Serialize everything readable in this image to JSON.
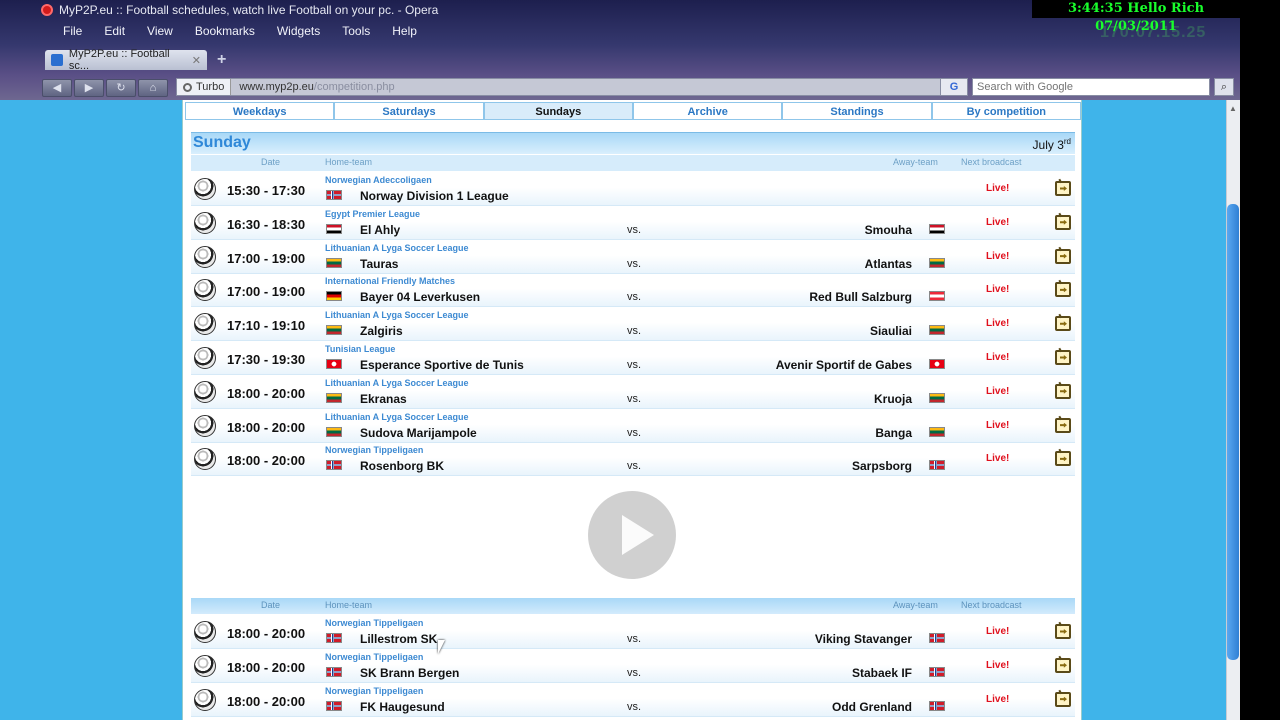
{
  "window": {
    "title": "MyP2P.eu :: Football schedules, watch live Football on your pc. - Opera",
    "clock_overlay": "3:44:35 Hello Rich 07/03/2011",
    "clock_ghost": "170:07.15.25"
  },
  "menu": [
    "File",
    "Edit",
    "View",
    "Bookmarks",
    "Widgets",
    "Tools",
    "Help"
  ],
  "tab": {
    "label": "MyP2P.eu :: Football sc...",
    "close": "✕"
  },
  "newtab": "+",
  "address": {
    "turbo": "Turbo",
    "domain": "www.myp2p.eu",
    "path": "/competition.php"
  },
  "search": {
    "placeholder": "Search with Google",
    "engine": "G"
  },
  "nav_tabs": [
    {
      "label": "Weekdays"
    },
    {
      "label": "Saturdays"
    },
    {
      "label": "Sundays",
      "active": true
    },
    {
      "label": "Archive"
    },
    {
      "label": "Standings"
    },
    {
      "label": "By competition"
    }
  ],
  "section": {
    "day": "Sunday",
    "date": "July 3",
    "date_sup": "rd"
  },
  "columns": {
    "date": "Date",
    "home": "Home-team",
    "away": "Away-team",
    "next": "Next broadcast"
  },
  "matches_top": [
    {
      "time": "15:30 - 17:30",
      "league": "Norwegian Adeccoligaen",
      "home": "Norway Division 1 League",
      "vs": "",
      "away": "",
      "home_flag": "no",
      "away_flag": "",
      "status": "Live!"
    },
    {
      "time": "16:30 - 18:30",
      "league": "Egypt Premier League",
      "home": "El Ahly",
      "vs": "vs.",
      "away": "Smouha",
      "home_flag": "eg",
      "away_flag": "eg",
      "status": "Live!"
    },
    {
      "time": "17:00 - 19:00",
      "league": "Lithuanian A Lyga Soccer League",
      "home": "Tauras",
      "vs": "vs.",
      "away": "Atlantas",
      "home_flag": "lt",
      "away_flag": "lt",
      "status": "Live!"
    },
    {
      "time": "17:00 - 19:00",
      "league": "International Friendly Matches",
      "home": "Bayer 04 Leverkusen",
      "vs": "vs.",
      "away": "Red Bull Salzburg",
      "home_flag": "de",
      "away_flag": "at",
      "status": "Live!"
    },
    {
      "time": "17:10 - 19:10",
      "league": "Lithuanian A Lyga Soccer League",
      "home": "Zalgiris",
      "vs": "vs.",
      "away": "Siauliai",
      "home_flag": "lt",
      "away_flag": "lt",
      "status": "Live!"
    },
    {
      "time": "17:30 - 19:30",
      "league": "Tunisian League",
      "home": "Esperance Sportive de Tunis",
      "vs": "vs.",
      "away": "Avenir Sportif de Gabes",
      "home_flag": "tn",
      "away_flag": "tn",
      "status": "Live!"
    },
    {
      "time": "18:00 - 20:00",
      "league": "Lithuanian A Lyga Soccer League",
      "home": "Ekranas",
      "vs": "vs.",
      "away": "Kruoja",
      "home_flag": "lt",
      "away_flag": "lt",
      "status": "Live!"
    },
    {
      "time": "18:00 - 20:00",
      "league": "Lithuanian A Lyga Soccer League",
      "home": "Sudova Marijampole",
      "vs": "vs.",
      "away": "Banga",
      "home_flag": "lt",
      "away_flag": "lt",
      "status": "Live!"
    },
    {
      "time": "18:00 - 20:00",
      "league": "Norwegian Tippeligaen",
      "home": "Rosenborg BK",
      "vs": "vs.",
      "away": "Sarpsborg",
      "home_flag": "no",
      "away_flag": "no",
      "status": "Live!"
    }
  ],
  "matches_bottom": [
    {
      "time": "18:00 - 20:00",
      "league": "Norwegian Tippeligaen",
      "home": "Lillestrom SK",
      "vs": "vs.",
      "away": "Viking Stavanger",
      "home_flag": "no",
      "away_flag": "no",
      "status": "Live!"
    },
    {
      "time": "18:00 - 20:00",
      "league": "Norwegian Tippeligaen",
      "home": "SK Brann Bergen",
      "vs": "vs.",
      "away": "Stabaek IF",
      "home_flag": "no",
      "away_flag": "no",
      "status": "Live!"
    },
    {
      "time": "18:00 - 20:00",
      "league": "Norwegian Tippeligaen",
      "home": "FK Haugesund",
      "vs": "vs.",
      "away": "Odd Grenland",
      "home_flag": "no",
      "away_flag": "no",
      "status": "Live!"
    }
  ],
  "flag_colors": {
    "no": [
      "#d01c2a",
      "#ffffff",
      "#1d3f8f"
    ],
    "eg": [
      "#ce1126",
      "#ffffff",
      "#000000"
    ],
    "lt": [
      "#fdb913",
      "#006a44",
      "#c1272d"
    ],
    "de": [
      "#000000",
      "#dd0000",
      "#ffce00"
    ],
    "at": [
      "#ed2939",
      "#ffffff",
      "#ed2939"
    ],
    "tn": [
      "#e70013",
      "#ffffff",
      "#e70013"
    ]
  }
}
